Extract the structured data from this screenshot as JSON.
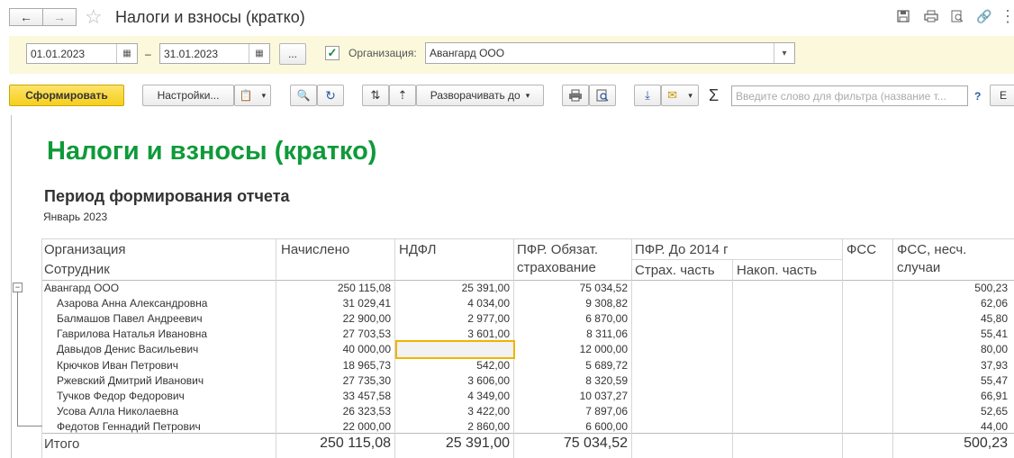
{
  "window": {
    "title": "Налоги и взносы (кратко)",
    "back_icon": "arrow-left-icon",
    "forward_icon": "arrow-right-icon",
    "favorite_icon": "star-icon"
  },
  "params": {
    "date_from": "01.01.2023",
    "dash": "–",
    "date_to": "31.01.2023",
    "more_label": "...",
    "org_label": "Организация:",
    "org_value": "Авангард ООО",
    "org_checked": true
  },
  "toolbar": {
    "generate_label": "Сформировать",
    "settings_label": "Настройки...",
    "expand_label": "Разворачивать до",
    "sigma": "Σ",
    "filter_placeholder": "Введите слово для фильтра (название т...",
    "help": "?",
    "cut_label": "Е"
  },
  "report": {
    "title": "Налоги и взносы (кратко)",
    "period_heading": "Период формирования отчета",
    "period_value": "Январь 2023",
    "headers": {
      "org": "Организация",
      "employee": "Сотрудник",
      "accrued": "Начислено",
      "ndfl": "НДФЛ",
      "pfr_mand_1": "ПФР. Обязат.",
      "pfr_mand_2": "страхование",
      "pfr_2014": "ПФР. До 2014 г",
      "pfr_ins": "Страх. часть",
      "pfr_acc": "Накоп. часть",
      "fss": "ФСС",
      "fss_acc_1": "ФСС, несч.",
      "fss_acc_2": "случаи"
    },
    "org_row": {
      "name": "Авангард ООО",
      "accrued": "250 115,08",
      "ndfl": "25 391,00",
      "pfr": "75 034,52",
      "fss_acc": "500,23"
    },
    "rows": [
      {
        "name": "Азарова Анна Александровна",
        "accrued": "31 029,41",
        "ndfl": "4 034,00",
        "pfr": "9 308,82",
        "fss_acc": "62,06"
      },
      {
        "name": "Балмашов Павел Андреевич",
        "accrued": "22 900,00",
        "ndfl": "2 977,00",
        "pfr": "6 870,00",
        "fss_acc": "45,80"
      },
      {
        "name": "Гаврилова Наталья Ивановна",
        "accrued": "27 703,53",
        "ndfl": "3 601,00",
        "pfr": "8 311,06",
        "fss_acc": "55,41"
      },
      {
        "name": "Давыдов Денис Васильевич",
        "accrued": "40 000,00",
        "ndfl": "",
        "pfr": "12 000,00",
        "fss_acc": "80,00"
      },
      {
        "name": "Крючков Иван Петрович",
        "accrued": "18 965,73",
        "ndfl": "542,00",
        "pfr": "5 689,72",
        "fss_acc": "37,93"
      },
      {
        "name": "Ржевский Дмитрий Иванович",
        "accrued": "27 735,30",
        "ndfl": "3 606,00",
        "pfr": "8 320,59",
        "fss_acc": "55,47"
      },
      {
        "name": "Тучков Федор Федорович",
        "accrued": "33 457,58",
        "ndfl": "4 349,00",
        "pfr": "10 037,27",
        "fss_acc": "66,91"
      },
      {
        "name": "Усова Алла Николаевна",
        "accrued": "26 323,53",
        "ndfl": "3 422,00",
        "pfr": "7 897,06",
        "fss_acc": "52,65"
      },
      {
        "name": "Федотов Геннадий Петрович",
        "accrued": "22 000,00",
        "ndfl": "2 860,00",
        "pfr": "6 600,00",
        "fss_acc": "44,00"
      }
    ],
    "total": {
      "label": "Итого",
      "accrued": "250 115,08",
      "ndfl": "25 391,00",
      "pfr": "75 034,52",
      "fss_acc": "500,23"
    }
  },
  "colors": {
    "accent_green": "#0f9a3a",
    "button_yellow": "#f7d52a",
    "param_bg": "#fbf8dc",
    "selection": "#f0b400"
  }
}
